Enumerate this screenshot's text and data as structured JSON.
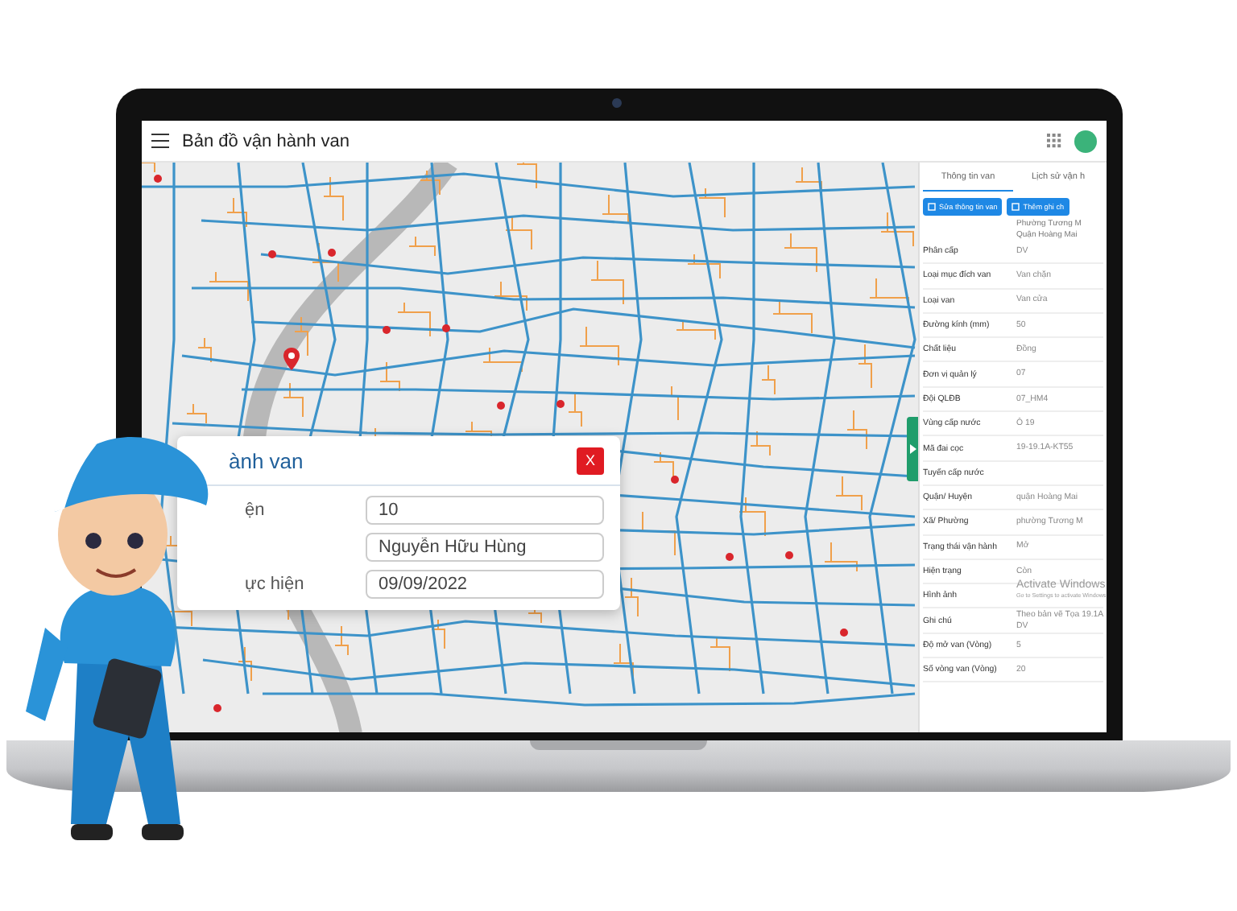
{
  "app": {
    "title": "Bản đồ vận hành van"
  },
  "dialog": {
    "title": "ành van",
    "close": "X",
    "fields": [
      {
        "label": "ện",
        "value": "10"
      },
      {
        "value": "Nguyễn Hữu Hùng"
      },
      {
        "label": "ực hiện",
        "value": "09/09/2022"
      }
    ]
  },
  "panel": {
    "tabs": [
      {
        "label": "Thông tin van",
        "selected": true
      },
      {
        "label": "Lịch sử vận h",
        "selected": false
      }
    ],
    "buttons": [
      "Sửa thông tin van",
      "Thêm ghi ch"
    ],
    "address": "Phường Tương M Quận Hoàng Mai",
    "rows": [
      {
        "label": "Phân cấp",
        "value": "DV"
      },
      {
        "label": "Loại mục đích van",
        "value": "Van chặn"
      },
      {
        "label": "Loại van",
        "value": "Van cửa"
      },
      {
        "label": "Đường kính (mm)",
        "value": "50"
      },
      {
        "label": "Chất liệu",
        "value": "Đồng"
      },
      {
        "label": "Đơn vị quản lý",
        "value": "07"
      },
      {
        "label": "Đội QLĐB",
        "value": "07_HM4"
      },
      {
        "label": "Vùng cấp nước",
        "value": "Ô 19"
      },
      {
        "label": "Mã đai cọc",
        "value": "19-19.1A-KT55"
      },
      {
        "label": "Tuyến cấp nước"
      },
      {
        "label": "Quận/ Huyện",
        "value": "quận Hoàng Mai"
      },
      {
        "label": "Xã/ Phường",
        "value": "phường Tương M"
      },
      {
        "label": "Trạng thái vận hành",
        "value": "Mở"
      },
      {
        "label": "Hiện trạng",
        "value": "Còn"
      },
      {
        "label": "Hình ảnh"
      },
      {
        "label": "Ghi chú",
        "value": "Theo bản vẽ Tọa 19.1A DV"
      },
      {
        "label": "Độ mở van (Vòng)",
        "value": "5"
      },
      {
        "label": "Số vòng van (Vòng)",
        "value": "20"
      }
    ]
  },
  "os_notice": {
    "title": "Activate Windows",
    "subtitle": "Go to Settings to activate Windows."
  }
}
